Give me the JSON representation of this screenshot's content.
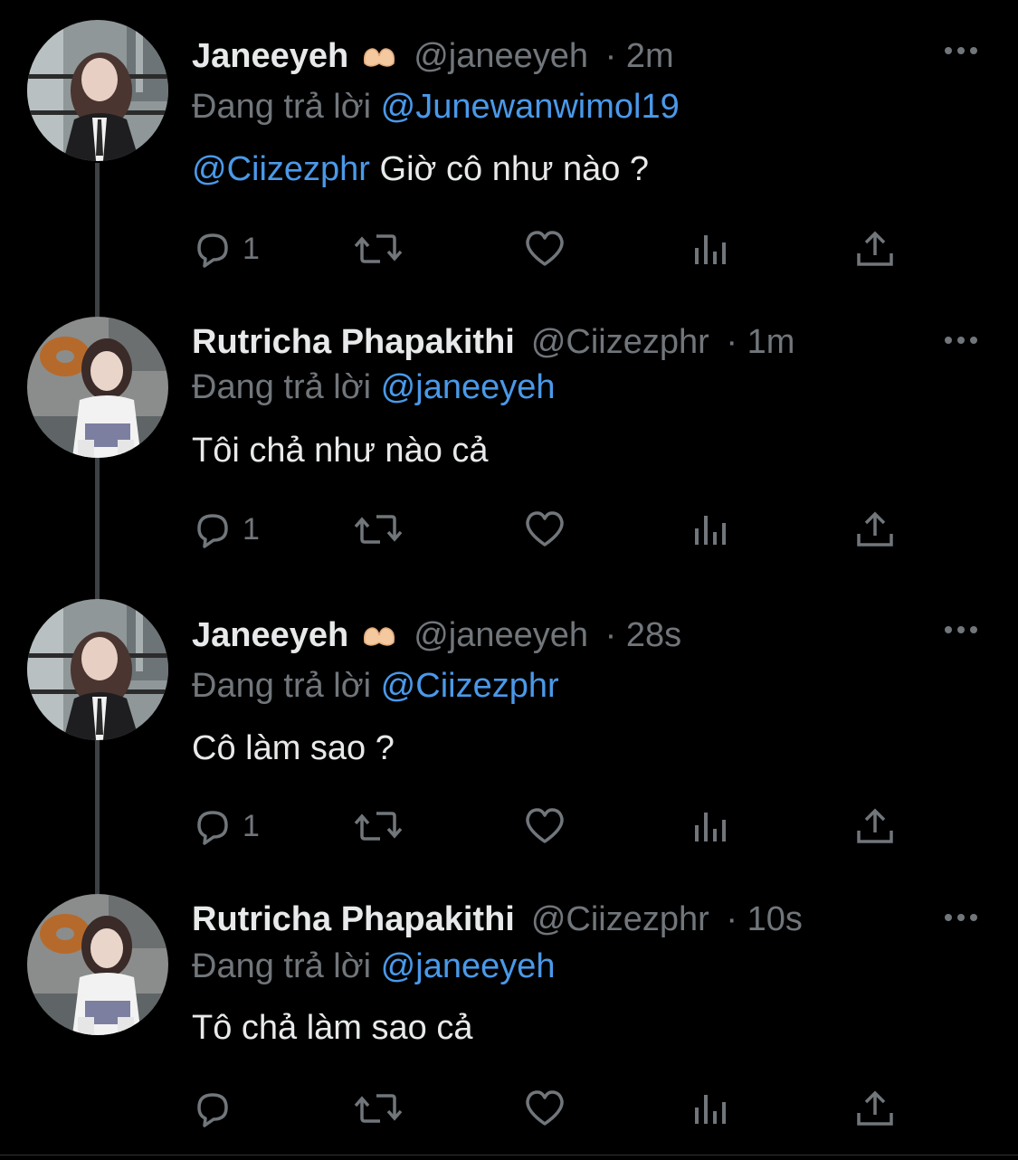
{
  "reply_prefix": "Đang trả lời",
  "colors": {
    "background": "#000000",
    "text": "#e7e9ea",
    "muted": "#71767b",
    "mention": "#4a99e9",
    "thread_line": "#3e4144"
  },
  "icons": {
    "reply": "reply-bubble-icon",
    "retweet": "retweet-icon",
    "like": "heart-icon",
    "views": "analytics-icon",
    "share": "share-icon",
    "more": "more-dots-icon",
    "name_emoji": "heart-hands-emoji"
  },
  "tweets": [
    {
      "name": "Janeeyeh",
      "handle": "@janeeyeh",
      "time": "· 2m",
      "reply_to": "@Junewanwimol19",
      "body_mention": "@Ciizezphr",
      "body_text": "Giờ cô như nào ?",
      "reply_count": "1",
      "has_emoji": true
    },
    {
      "name": "Rutricha Phapakithi",
      "handle": "@Ciizezphr",
      "time": "· 1m",
      "reply_to": "@janeeyeh",
      "body_mention": "",
      "body_text": "Tôi chả như nào cả",
      "reply_count": "1",
      "has_emoji": false
    },
    {
      "name": "Janeeyeh",
      "handle": "@janeeyeh",
      "time": "· 28s",
      "reply_to": "@Ciizezphr",
      "body_mention": "",
      "body_text": "Cô làm sao ?",
      "reply_count": "1",
      "has_emoji": true
    },
    {
      "name": "Rutricha Phapakithi",
      "handle": "@Ciizezphr",
      "time": "· 10s",
      "reply_to": "@janeeyeh",
      "body_mention": "",
      "body_text": "Tô chả làm sao cả",
      "reply_count": "",
      "has_emoji": false
    }
  ]
}
